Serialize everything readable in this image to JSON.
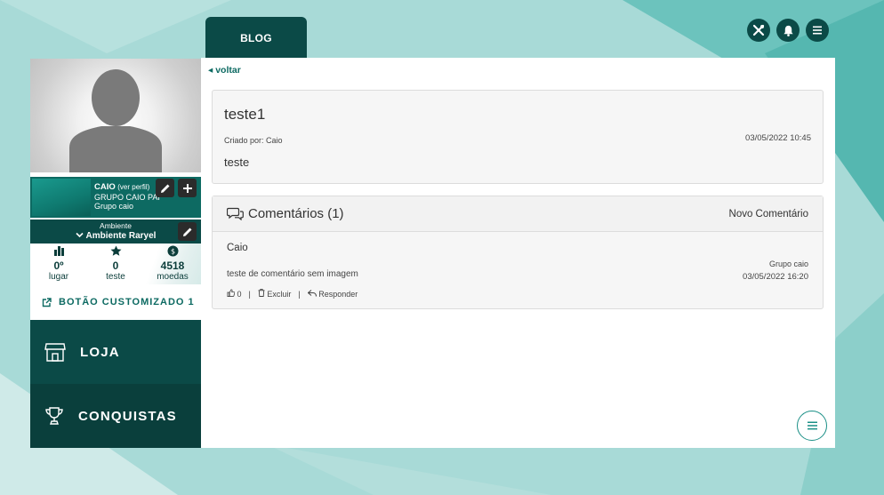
{
  "header": {
    "tab_label": "BLOG",
    "icons": [
      "tools-icon",
      "bell-icon",
      "menu-icon"
    ]
  },
  "profile": {
    "name": "CAIO",
    "view_profile": "(ver perfil)",
    "group_parent": "GRUPO CAIO PAI",
    "group": "Grupo caio"
  },
  "environment": {
    "label": "Ambiente",
    "value": "Ambiente Raryel"
  },
  "stats": [
    {
      "value": "0º",
      "label": "lugar",
      "icon": "bar-chart-icon"
    },
    {
      "value": "0",
      "label": "teste",
      "icon": "star-icon"
    },
    {
      "value": "4518",
      "label": "moedas",
      "icon": "coin-icon"
    }
  ],
  "sidebar": {
    "custom_button": "BOTÃO CUSTOMIZADO 1",
    "items": [
      {
        "label": "LOJA",
        "icon": "store-icon"
      },
      {
        "label": "CONQUISTAS",
        "icon": "trophy-icon"
      }
    ]
  },
  "nav": {
    "back_label": "voltar"
  },
  "post": {
    "title": "teste1",
    "author": "Criado por: Caio",
    "date": "03/05/2022 10:45",
    "body": "teste"
  },
  "comments": {
    "title": "Comentários (1)",
    "new_label": "Novo Comentário",
    "items": [
      {
        "author": "Caio",
        "text": "teste de comentário sem imagem",
        "group": "Grupo caio",
        "date": "03/05/2022 16:20",
        "likes": "0",
        "delete_label": "Excluir",
        "reply_label": "Responder"
      }
    ]
  },
  "colors": {
    "dark_teal": "#0b4a47",
    "accent": "#0d6a62",
    "background": "#9fd6d3"
  }
}
